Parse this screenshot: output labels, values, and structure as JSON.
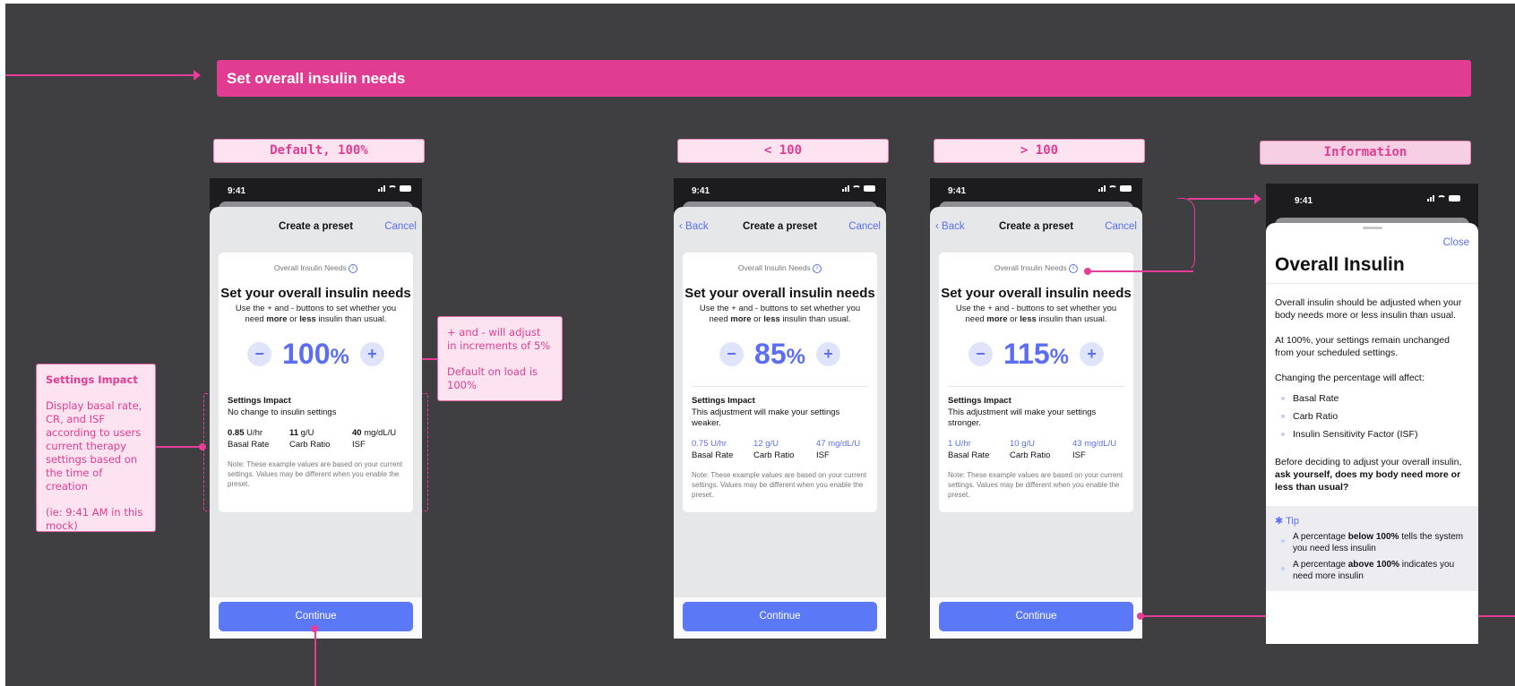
{
  "banner": {
    "title": "Set overall insulin needs"
  },
  "labels": {
    "default": "Default, 100%",
    "less": "< 100",
    "more": "> 100",
    "information": "Information"
  },
  "annotations": {
    "settings_impact": {
      "title": "Settings Impact",
      "body": "Display basal rate, CR, and ISF according to users current therapy settings based on the time of creation",
      "example": "(ie: 9:41 AM in this mock)"
    },
    "increments": {
      "line1": "+ and - will adjust in increments of 5%",
      "line2": "Default on load is 100%"
    }
  },
  "colors": {
    "accent": "#e03d92",
    "brand_blue": "#5b78f6",
    "canvas": "#3f3e40"
  },
  "screens": [
    {
      "time": "9:41",
      "nav": {
        "title": "Create a preset",
        "back": "",
        "cancel": "Cancel"
      },
      "kicker": "Overall Insulin Needs",
      "title": "Set your overall insulin needs",
      "subtitle_1": "Use the + and - buttons to set whether you need ",
      "subtitle_more": "more",
      "subtitle_or": " or ",
      "subtitle_less": "less",
      "subtitle_2": " insulin than usual.",
      "percent": "100",
      "percent_sign": "%",
      "impact_title": "Settings Impact",
      "impact_desc": "No change to insulin settings",
      "values": [
        {
          "value": "0.85",
          "unit": " U/hr",
          "label": "Basal Rate"
        },
        {
          "value": "11",
          "unit": " g/U",
          "label": "Carb Ratio"
        },
        {
          "value": "40",
          "unit": " mg/dL/U",
          "label": "ISF"
        }
      ],
      "note": "Note: These example values are based on your current settings. Values may be different when you enable the preset.",
      "continue": "Continue"
    },
    {
      "time": "9:41",
      "nav": {
        "title": "Create a preset",
        "back": "Back",
        "cancel": "Cancel"
      },
      "kicker": "Overall Insulin Needs",
      "title": "Set your overall insulin needs",
      "subtitle_1": "Use the + and - buttons to set whether you need ",
      "subtitle_more": "more",
      "subtitle_or": " or ",
      "subtitle_less": "less",
      "subtitle_2": " insulin than usual.",
      "percent": "85",
      "percent_sign": "%",
      "impact_title": "Settings Impact",
      "impact_desc": "This adjustment will make your settings weaker.",
      "values": [
        {
          "value": "0.75",
          "unit": " U/hr",
          "label": "Basal Rate"
        },
        {
          "value": "12",
          "unit": " g/U",
          "label": "Carb Ratio"
        },
        {
          "value": "47",
          "unit": " mg/dL/U",
          "label": "ISF"
        }
      ],
      "note": "Note: These example values are based on your current settings. Values may be different when you enable the preset.",
      "continue": "Continue"
    },
    {
      "time": "9:41",
      "nav": {
        "title": "Create a preset",
        "back": "Back",
        "cancel": "Cancel"
      },
      "kicker": "Overall Insulin Needs",
      "title": "Set your overall insulin needs",
      "subtitle_1": "Use the + and - buttons to set whether you need ",
      "subtitle_more": "more",
      "subtitle_or": " or ",
      "subtitle_less": "less",
      "subtitle_2": " insulin than usual.",
      "percent": "115",
      "percent_sign": "%",
      "impact_title": "Settings Impact",
      "impact_desc": "This adjustment will make your settings stronger.",
      "values": [
        {
          "value": "1",
          "unit": " U/hr",
          "label": "Basal Rate"
        },
        {
          "value": "10",
          "unit": " g/U",
          "label": "Carb Ratio"
        },
        {
          "value": "43",
          "unit": " mg/dL/U",
          "label": "ISF"
        }
      ],
      "note": "Note: These example values are based on your current settings. Values may be different when you enable the preset.",
      "continue": "Continue"
    }
  ],
  "info": {
    "time": "9:41",
    "close": "Close",
    "title": "Overall Insulin",
    "p1": "Overall insulin should be adjusted when your body needs more or less insulin than usual.",
    "p2": "At 100%, your settings remain unchanged from your scheduled settings.",
    "p3": "Changing the percentage will affect:",
    "bullets": [
      "Basal Rate",
      "Carb Ratio",
      "Insulin Sensitivity Factor (ISF)"
    ],
    "p4_a": "Before deciding to adjust your overall insulin, ",
    "p4_b": "ask yourself, does my body need more or less than usual?",
    "tip_label": "Tip",
    "tip1_a": "A percentage ",
    "tip1_b": "below 100%",
    "tip1_c": " tells the system you need less insulin",
    "tip2_a": "A percentage ",
    "tip2_b": "above 100%",
    "tip2_c": " indicates you need more insulin"
  }
}
